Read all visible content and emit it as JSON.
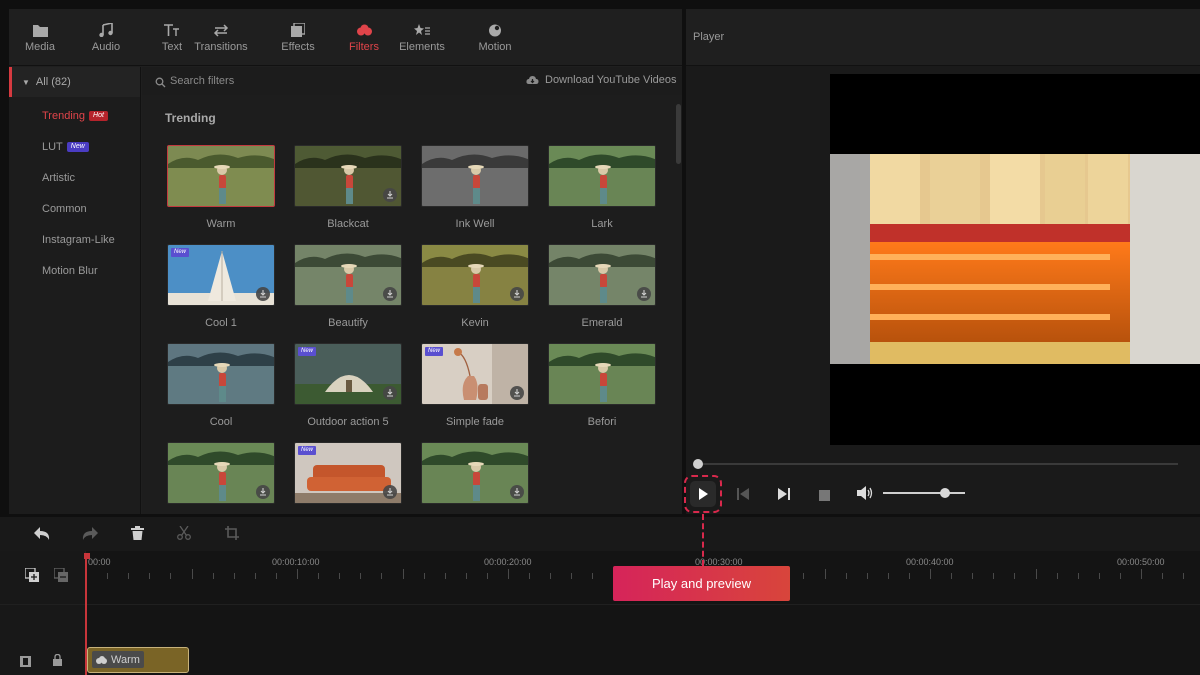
{
  "tabs": [
    {
      "label": "Media",
      "icon": "folder-icon"
    },
    {
      "label": "Audio",
      "icon": "music-note-icon"
    },
    {
      "label": "Text",
      "icon": "text-icon"
    },
    {
      "label": "Transitions",
      "icon": "transitions-icon"
    },
    {
      "label": "Effects",
      "icon": "effects-icon"
    },
    {
      "label": "Filters",
      "icon": "filters-icon",
      "active": true
    },
    {
      "label": "Elements",
      "icon": "elements-icon"
    },
    {
      "label": "Motion",
      "icon": "motion-icon"
    }
  ],
  "categories": {
    "all_label": "All (82)",
    "items": [
      {
        "label": "Trending",
        "badge": "Hot",
        "active": true
      },
      {
        "label": "LUT",
        "badge": "New"
      },
      {
        "label": "Artistic"
      },
      {
        "label": "Common"
      },
      {
        "label": "Instagram-Like"
      },
      {
        "label": "Motion Blur"
      }
    ]
  },
  "search": {
    "placeholder": "Search filters"
  },
  "download_link": "Download YouTube Videos",
  "section_title": "Trending",
  "filters": [
    {
      "label": "Warm",
      "selected": true,
      "download": false,
      "new": false,
      "theme": "field-warm"
    },
    {
      "label": "Blackcat",
      "download": true,
      "theme": "field-dark"
    },
    {
      "label": "Ink Well",
      "download": false,
      "theme": "field-gray"
    },
    {
      "label": "Lark",
      "download": false,
      "theme": "field-normal"
    },
    {
      "label": "Cool 1",
      "download": true,
      "new": true,
      "theme": "tent-blue"
    },
    {
      "label": "Beautify",
      "download": true,
      "theme": "field-soft"
    },
    {
      "label": "Kevin",
      "download": true,
      "theme": "field-gold"
    },
    {
      "label": "Emerald",
      "download": true,
      "theme": "field-soft"
    },
    {
      "label": "Cool",
      "download": false,
      "theme": "field-cool"
    },
    {
      "label": "Outdoor action 5",
      "download": true,
      "new": true,
      "theme": "tent-green"
    },
    {
      "label": "Simple fade",
      "download": true,
      "new": true,
      "theme": "vase"
    },
    {
      "label": "Befori",
      "download": false,
      "theme": "field-normal"
    },
    {
      "label": "",
      "download": true,
      "theme": "field-normal"
    },
    {
      "label": "",
      "download": true,
      "new": true,
      "theme": "sofa"
    },
    {
      "label": "",
      "download": true,
      "theme": "field-normal"
    }
  ],
  "new_tag": "New",
  "player": {
    "title": "Player",
    "volume": 0.75
  },
  "timeline": {
    "time_labels": [
      "00:00",
      "00:00:10:00",
      "00:00:20:00",
      "00:00:30:00",
      "00:00:40:00",
      "00:00:50:00"
    ],
    "clip_label": "Warm"
  },
  "tooltip": "Play and preview",
  "colors": {
    "accent": "#e0444a",
    "tooltip_start": "#d6245a",
    "tooltip_end": "#d8453b"
  }
}
